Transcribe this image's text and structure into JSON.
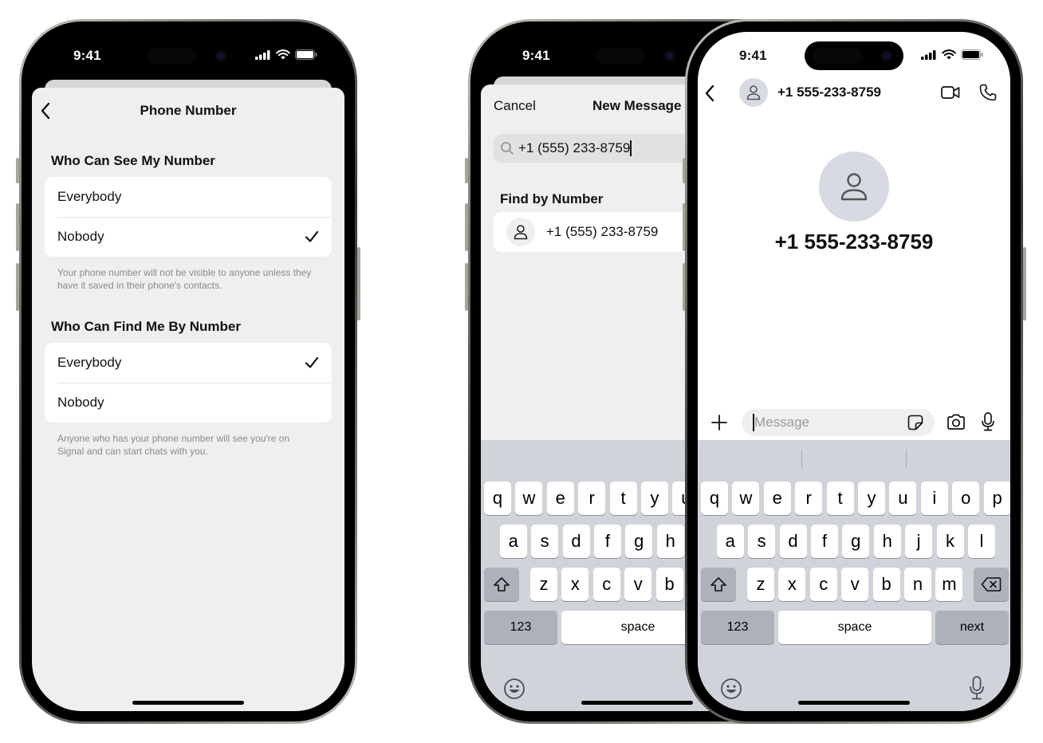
{
  "status_bar": {
    "time": "9:41"
  },
  "phone1": {
    "nav_title": "Phone Number",
    "sections": [
      {
        "title": "Who Can See My Number",
        "options": [
          {
            "label": "Everybody",
            "selected": false
          },
          {
            "label": "Nobody",
            "selected": true
          }
        ],
        "footnote": "Your phone number will not be visible to anyone unless they have it saved in their phone's contacts."
      },
      {
        "title": "Who Can Find Me By Number",
        "options": [
          {
            "label": "Everybody",
            "selected": true
          },
          {
            "label": "Nobody",
            "selected": false
          }
        ],
        "footnote": "Anyone who has your phone number will see you're on Signal and can start chats with you."
      }
    ]
  },
  "phone2": {
    "cancel_label": "Cancel",
    "nav_title": "New Message",
    "search_value": "+1 (555) 233-8759",
    "section_title": "Find by Number",
    "result_number": "+1 (555) 233-8759"
  },
  "phone3": {
    "contact_number": "+1 555-233-8759",
    "profile_number": "+1 555-233-8759",
    "message_placeholder": "Message"
  },
  "keyboard": {
    "row1": [
      "q",
      "w",
      "e",
      "r",
      "t",
      "y",
      "u",
      "i",
      "o",
      "p"
    ],
    "row2": [
      "a",
      "s",
      "d",
      "f",
      "g",
      "h",
      "j",
      "k",
      "l"
    ],
    "row3": [
      "z",
      "x",
      "c",
      "v",
      "b",
      "n",
      "m"
    ],
    "numbers_label": "123",
    "space_label": "space",
    "next_label": "next"
  },
  "icons": {
    "back": "chevron-left-icon",
    "check": "checkmark-icon",
    "search": "magnifier-icon",
    "person": "person-icon",
    "video": "video-camera-icon",
    "phone": "phone-icon",
    "plus": "plus-icon",
    "sticker": "sticker-icon",
    "camera": "camera-icon",
    "mic": "microphone-icon",
    "emoji": "emoji-icon",
    "shift": "shift-icon",
    "delete": "delete-icon"
  },
  "colors": {
    "sheet_bg": "#efefef",
    "group_bg": "#ffffff",
    "footnote": "#8a8a8a",
    "keyboard_bg": "#d0d3d9",
    "special_key": "#adb1ba",
    "avatar_bg": "#d7dae2"
  }
}
